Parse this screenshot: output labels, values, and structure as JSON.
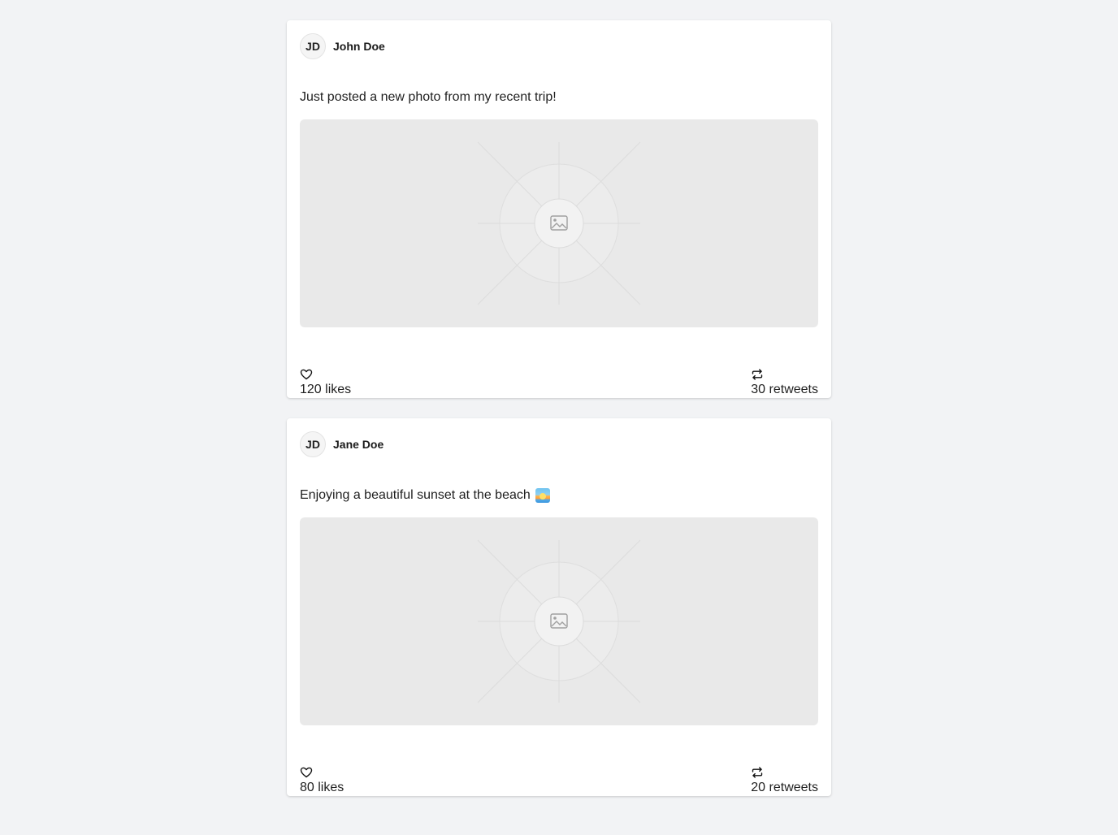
{
  "posts": [
    {
      "avatar_initials": "JD",
      "author": "John Doe",
      "text": "Just posted a new photo from my recent trip!",
      "emoji": "",
      "likes": "120 likes",
      "retweets": "30 retweets",
      "like_icon": "heart-icon",
      "retweet_icon": "retweet-icon",
      "image_icon": "image-placeholder-icon"
    },
    {
      "avatar_initials": "JD",
      "author": "Jane Doe",
      "text": "Enjoying a beautiful sunset at the beach",
      "emoji": "sunset-emoji",
      "likes": "80 likes",
      "retweets": "20 retweets",
      "like_icon": "heart-icon",
      "retweet_icon": "retweet-icon",
      "image_icon": "image-placeholder-icon"
    }
  ],
  "colors": {
    "page_background": "#f2f3f5",
    "card_background": "#ffffff",
    "image_placeholder": "#e9e9e9"
  }
}
